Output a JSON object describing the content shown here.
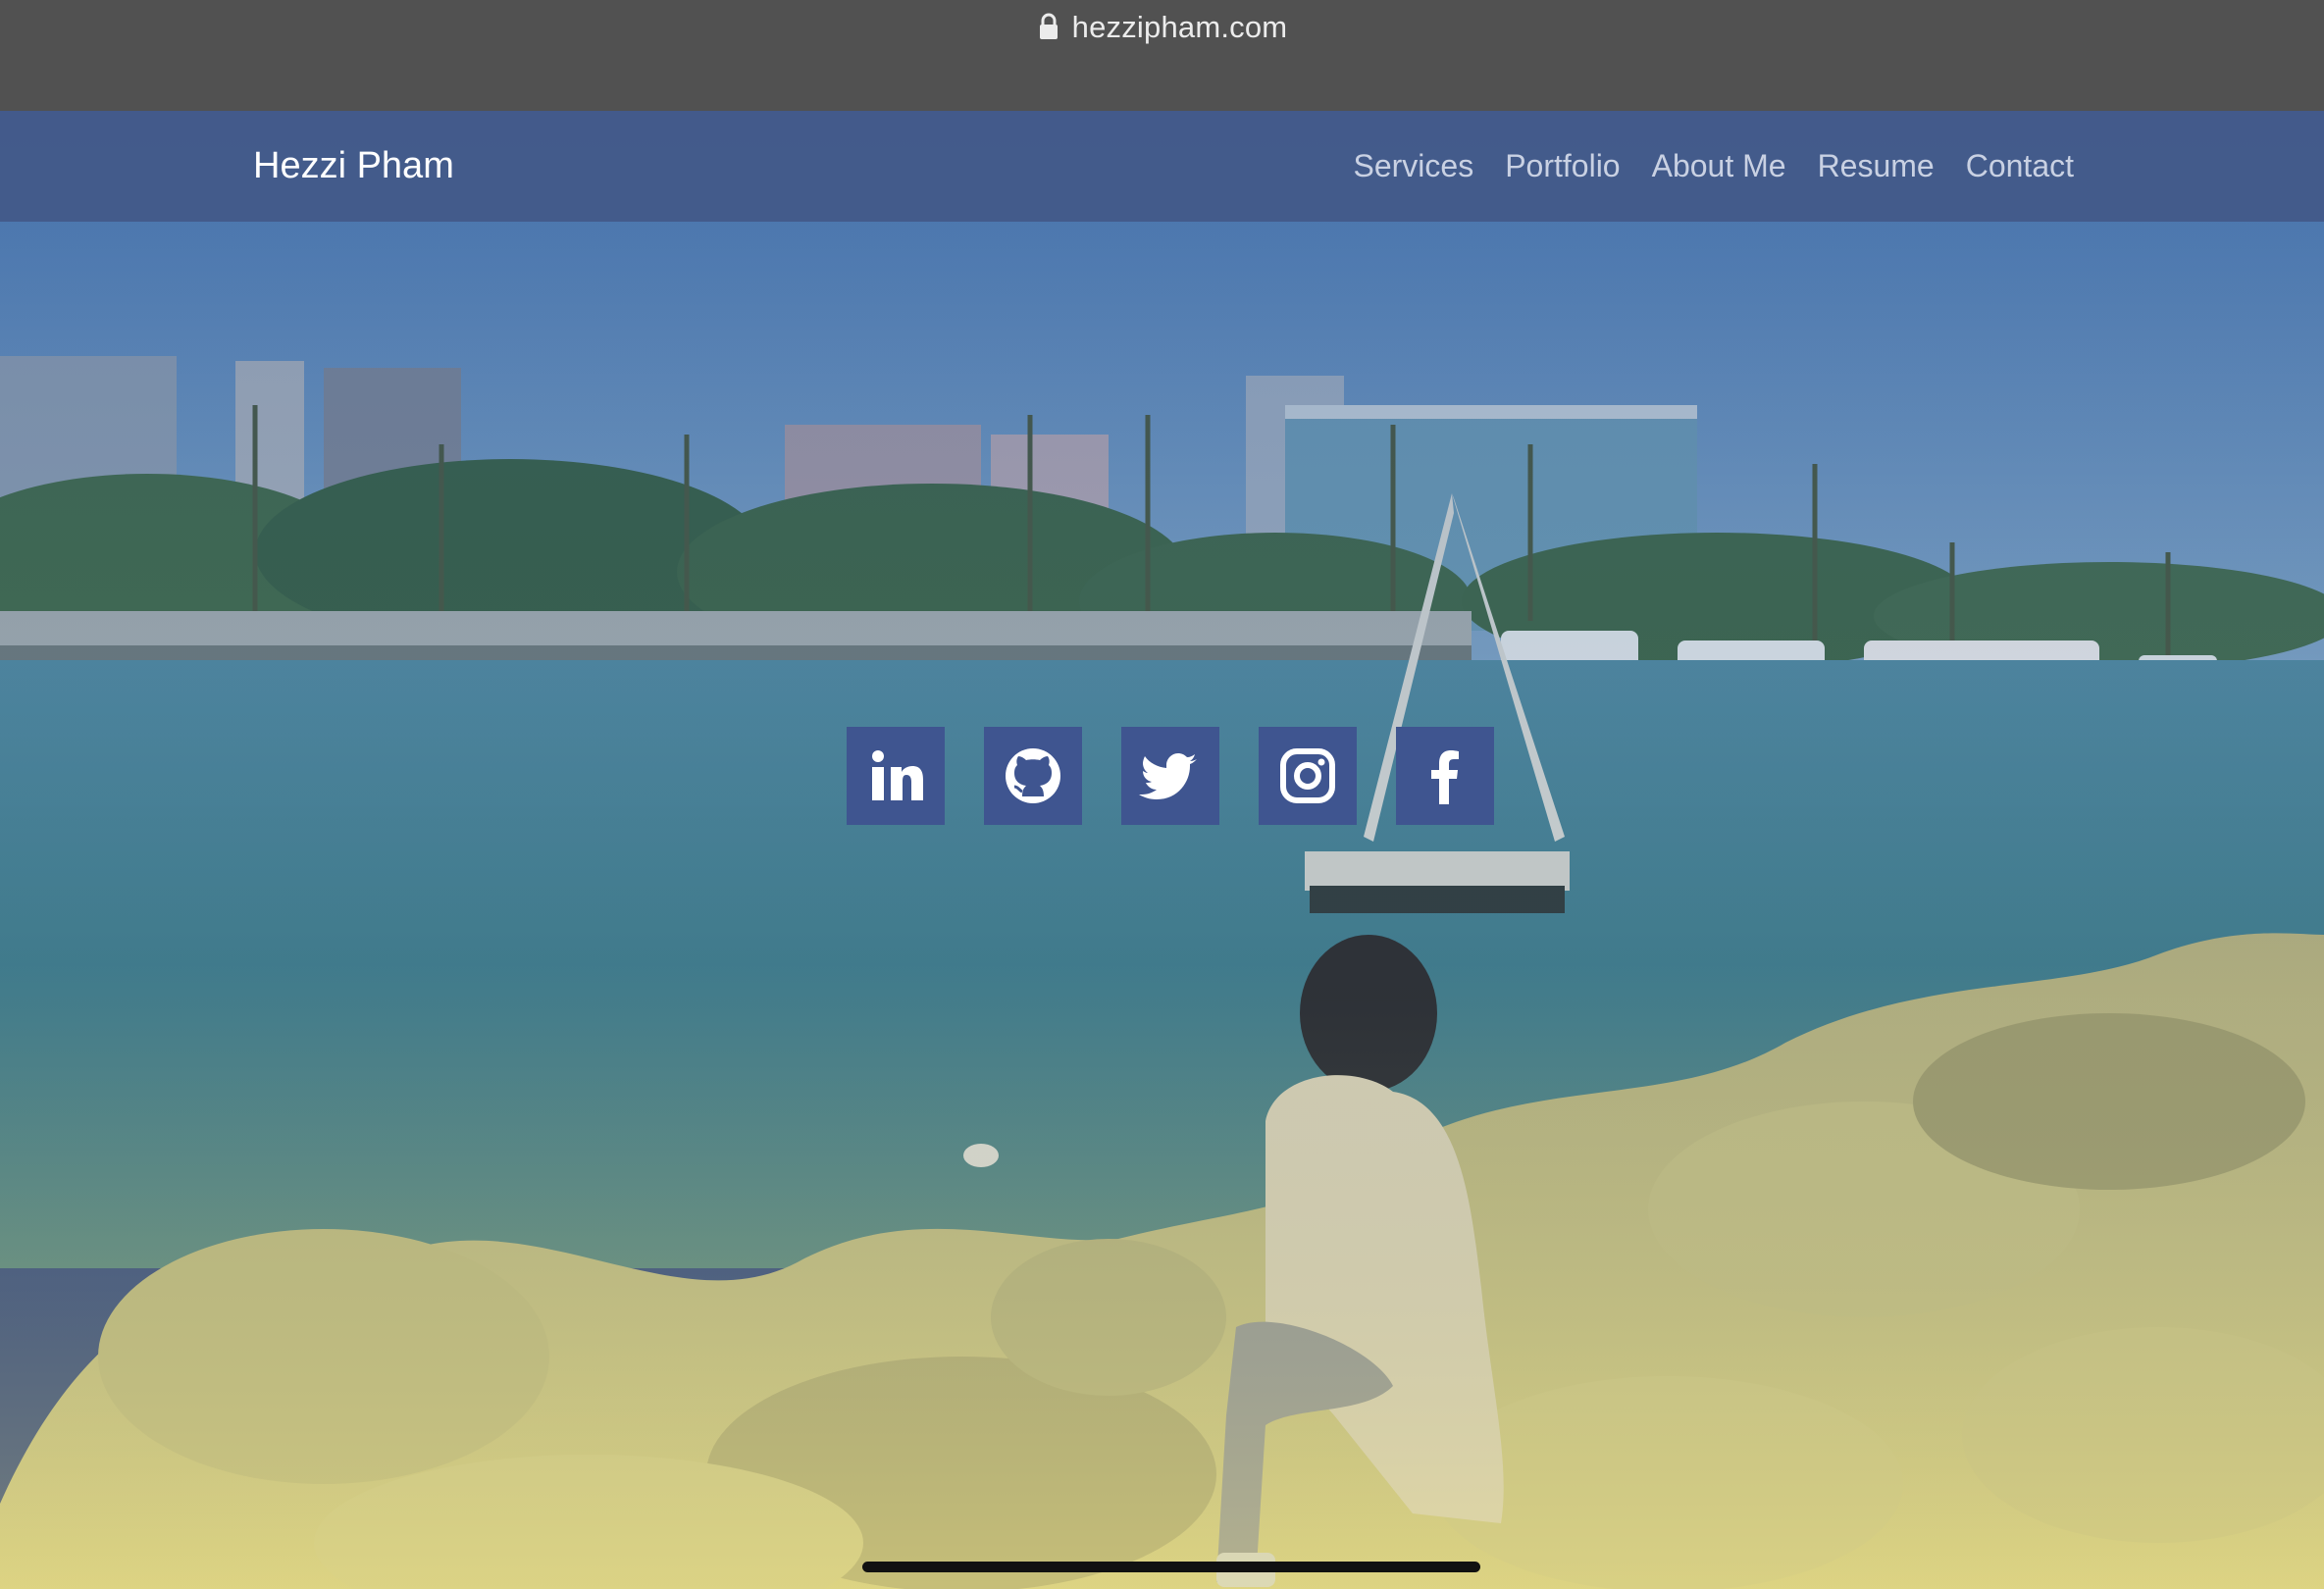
{
  "browser": {
    "url": "hezzipham.com",
    "lock_icon": "lock-icon"
  },
  "navbar": {
    "brand": "Hezzi Pham",
    "links": [
      {
        "label": "Services"
      },
      {
        "label": "Portfolio"
      },
      {
        "label": "About Me"
      },
      {
        "label": "Resume"
      },
      {
        "label": "Contact"
      }
    ]
  },
  "hero": {
    "background": "photo of a woman sitting on harbor rocks with marina, palm trees and buildings behind",
    "overlay_color_top": "#4a7ab5",
    "overlay_color_bottom": "#d8d28a"
  },
  "social": [
    {
      "name": "LinkedIn",
      "icon": "linkedin-icon"
    },
    {
      "name": "GitHub",
      "icon": "github-icon"
    },
    {
      "name": "Twitter",
      "icon": "twitter-icon"
    },
    {
      "name": "Instagram",
      "icon": "instagram-icon"
    },
    {
      "name": "Facebook",
      "icon": "facebook-icon"
    }
  ],
  "colors": {
    "navbar": "#435a89",
    "social_tile": "#3f5590",
    "url_bar": "#515151"
  }
}
